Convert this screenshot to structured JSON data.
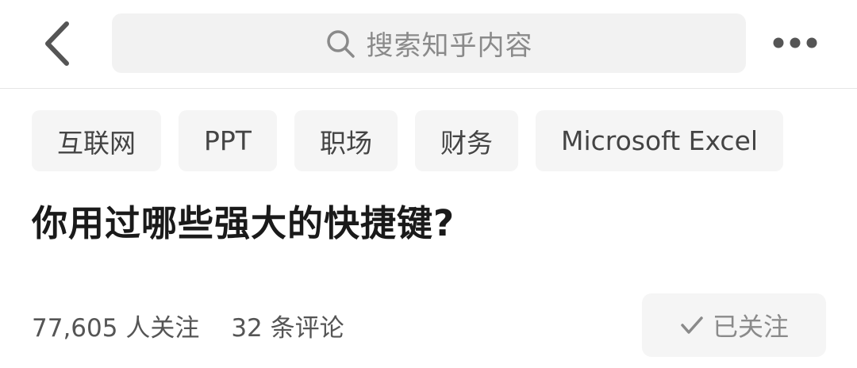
{
  "search": {
    "placeholder": "搜索知乎内容"
  },
  "icons": {
    "back": "chevron-left-icon",
    "search": "search-icon",
    "more": "more-dots-icon",
    "check": "check-icon"
  },
  "tags": [
    "互联网",
    "PPT",
    "职场",
    "财务",
    "Microsoft Excel"
  ],
  "question": {
    "title": "你用过哪些强大的快捷键?"
  },
  "stats": {
    "followers": "77,605 人关注",
    "comments": "32 条评论"
  },
  "follow_button": {
    "label": "已关注"
  },
  "colors": {
    "search_bg": "#f2f2f2",
    "tag_bg": "#f5f5f5",
    "muted_text": "#8a8a8a",
    "title_text": "#1a1a1a"
  }
}
